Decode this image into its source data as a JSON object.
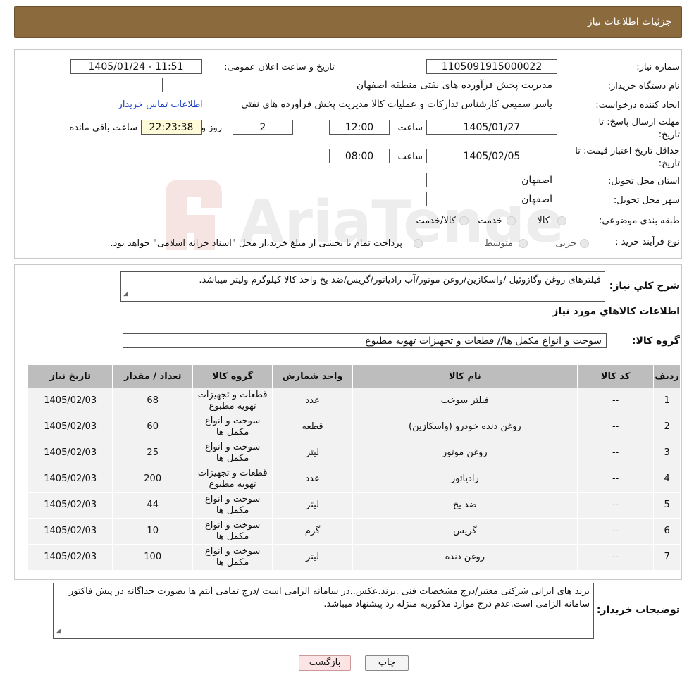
{
  "header": {
    "title": "جزئیات اطلاعات نیاز"
  },
  "need": {
    "need_number_label": "شماره نیاز:",
    "need_number": "1105091915000022",
    "announce_label": "تاریخ و ساعت اعلان عمومی:",
    "announce_value": "1405/01/24 - 11:51",
    "buyer_label": "نام دستگاه خریدار:",
    "buyer_value": "مدیریت پخش فرآورده های نفتی منطقه اصفهان",
    "creator_label": "ایجاد کننده درخواست:",
    "creator_value": "یاسر  سمیعی کارشناس تدارکات و عملیات کالا مدیریت پخش فرآورده های نفتی",
    "contact_link": "اطلاعات تماس خریدار",
    "deadline_label_1": "مهلت ارسال پاسخ: تا",
    "deadline_label_2": "تاریخ:",
    "deadline_date": "1405/01/27",
    "time_label": "ساعت",
    "deadline_time": "12:00",
    "days_value": "2",
    "days_label": "روز و",
    "remaining_time": "22:23:38",
    "remaining_label": "ساعت باقي مانده",
    "validity_label_1": "حداقل تاریخ اعتبار قیمت: تا",
    "validity_label_2": "تاریخ:",
    "validity_date": "1405/02/05",
    "validity_time": "08:00",
    "province_label": "استان محل تحویل:",
    "province_value": "اصفهان",
    "city_label": "شهر محل تحویل:",
    "city_value": "اصفهان",
    "category_label": "طبقه بندی موضوعی:",
    "category_options": [
      "کالا",
      "خدمت",
      "کالا/خدمت"
    ],
    "process_label": "نوع فرآیند خرید :",
    "process_options": [
      "جزیی",
      "متوسط"
    ],
    "process_note": "پرداخت تمام یا بخشی از مبلغ خرید،از محل \"اسناد خزانه اسلامی\" خواهد بود."
  },
  "summary": {
    "description_label": "شرح کلي نیاز:",
    "description_value": "فیلترهای روغن وگازوئیل /واسکازین/روغن موتور/آب رادیاتور/گریس/ضد یخ      واحد کالا کیلوگرم ولیتر میباشد.",
    "items_title": "اطلاعات کالاهاي مورد نیاز",
    "group_label": "گروه کالا:",
    "group_value": "سوخت و انواع مکمل ها//  قطعات و تجهیزات تهویه مطبوع"
  },
  "table": {
    "headers": [
      "ردیف",
      "کد کالا",
      "نام کالا",
      "واحد شمارش",
      "گروه کالا",
      "تعداد / مقدار",
      "تاریخ نیاز"
    ],
    "rows": [
      [
        "1",
        "--",
        "فیلتر سوخت",
        "عدد",
        "قطعات و تجهیزات تهویه مطبوع",
        "68",
        "1405/02/03"
      ],
      [
        "2",
        "--",
        "روغن دنده خودرو (واسکازین)",
        "قطعه",
        "سوخت و انواع مکمل ها",
        "60",
        "1405/02/03"
      ],
      [
        "3",
        "--",
        "روغن موتور",
        "لیتر",
        "سوخت و انواع مکمل ها",
        "25",
        "1405/02/03"
      ],
      [
        "4",
        "--",
        "رادیاتور",
        "عدد",
        "قطعات و تجهیزات تهویه مطبوع",
        "200",
        "1405/02/03"
      ],
      [
        "5",
        "--",
        "ضد یخ",
        "لیتر",
        "سوخت و انواع مکمل ها",
        "44",
        "1405/02/03"
      ],
      [
        "6",
        "--",
        "گریس",
        "گرم",
        "سوخت و انواع مکمل ها",
        "10",
        "1405/02/03"
      ],
      [
        "7",
        "--",
        "روغن دنده",
        "لیتر",
        "سوخت و انواع مکمل ها",
        "100",
        "1405/02/03"
      ]
    ]
  },
  "notes": {
    "label": "توضیحات خریدار:",
    "value": "برند های ایرانی شرکتی معتبر/درج مشخصات فنی .برند.عکس..در سامانه الزامی است /درج تمامی آیتم ها بصورت جداگانه در پیش فاکتور سامانه الزامی است.عدم درج موارد مذکوربه منزله رد پیشنهاد میباشد."
  },
  "buttons": {
    "print": "چاپ",
    "back": "بازگشت"
  },
  "watermark": {
    "text": "AriaTender.neT"
  },
  "colors": {
    "header_bg": "#8b6a3e",
    "link": "#1a3fc0",
    "table_head": "#bdbdbd",
    "back_btn": "#fde4e4"
  }
}
